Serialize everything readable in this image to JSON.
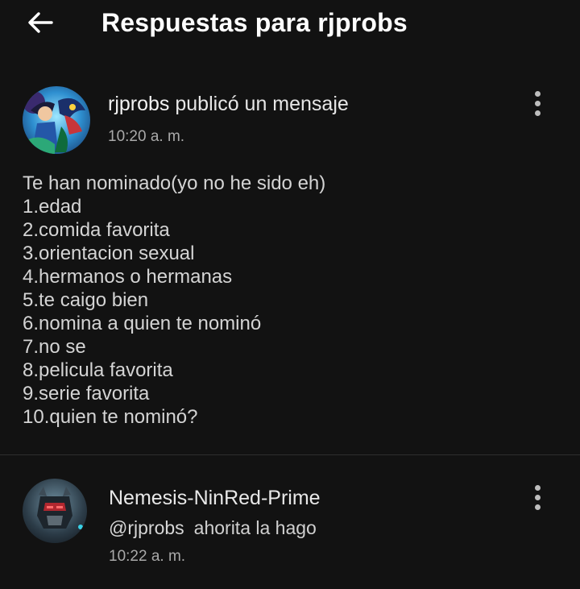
{
  "header": {
    "title": "Respuestas para rjprobs",
    "back_icon": "arrow-left-icon"
  },
  "post": {
    "author": "rjprobs",
    "action": " publicó un mensaje",
    "time": "10:20 a. m.",
    "menu_icon": "more-vertical-icon",
    "lines": [
      "Te han nominado(yo no he sido eh)",
      "1.edad",
      "2.comida favorita",
      "3.orientacion sexual",
      "4.hermanos o hermanas",
      "5.te caigo bien",
      "6.nomina a quien te nominó",
      "7.no se",
      "8.pelicula favorita",
      "9.serie favorita",
      "10.quien te nominó?"
    ]
  },
  "reply": {
    "author": "Nemesis-NinRed-Prime",
    "mention": "@rjprobs",
    "text": "ahorita la hago",
    "time": "10:22 a. m.",
    "menu_icon": "more-vertical-icon"
  },
  "colors": {
    "background": "#121212",
    "text_primary": "#e8e8e8",
    "text_secondary": "#a9a9a9",
    "divider": "#2e2e2e"
  }
}
